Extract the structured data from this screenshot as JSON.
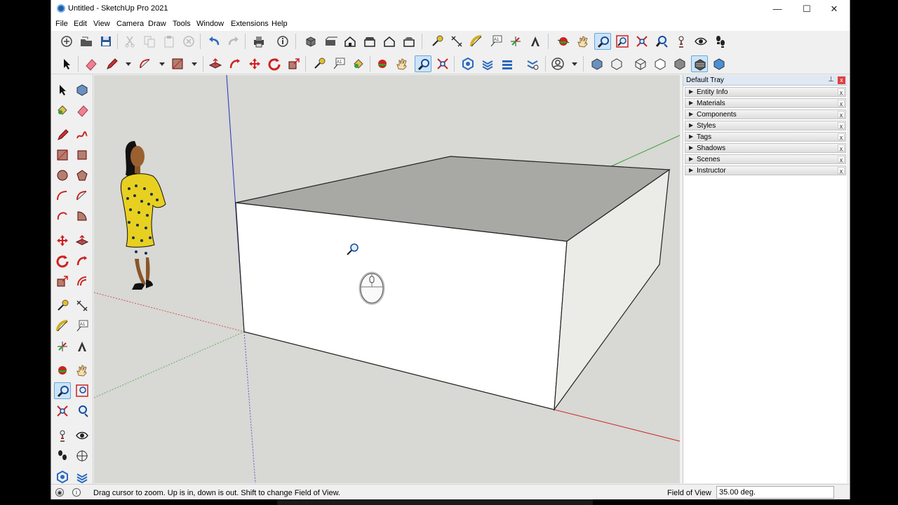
{
  "window": {
    "title": "Untitled - SketchUp Pro 2021",
    "minimize": "—",
    "maximize": "☐",
    "close": "✕"
  },
  "menu": [
    "File",
    "Edit",
    "View",
    "Camera",
    "Draw",
    "Tools",
    "Window",
    "Extensions",
    "Help"
  ],
  "tray": {
    "title": "Default Tray",
    "pin": "⊥",
    "close": "x",
    "panels": [
      {
        "label": "Entity Info",
        "close": "x"
      },
      {
        "label": "Materials",
        "close": "x"
      },
      {
        "label": "Components",
        "close": "x"
      },
      {
        "label": "Styles",
        "close": "x"
      },
      {
        "label": "Tags",
        "close": "x"
      },
      {
        "label": "Shadows",
        "close": "x"
      },
      {
        "label": "Scenes",
        "close": "x"
      },
      {
        "label": "Instructor",
        "close": "x"
      }
    ]
  },
  "status": {
    "message": "Drag cursor to zoom.  Up is in, down is out. Shift to change Field of View.",
    "info_icon": "i",
    "geo_icon": "◉",
    "measure_label": "Field of View",
    "measure_value": "35.00 deg."
  },
  "colors": {
    "accent_active": "#cce4f7",
    "axis_red": "#cc2020",
    "axis_green": "#30a030",
    "axis_blue": "#2030c0",
    "face_front": "#ffffff",
    "face_top": "#a8a8a4",
    "sky_ground": "#d8d8d4"
  },
  "active_tool": "zoom-tool"
}
